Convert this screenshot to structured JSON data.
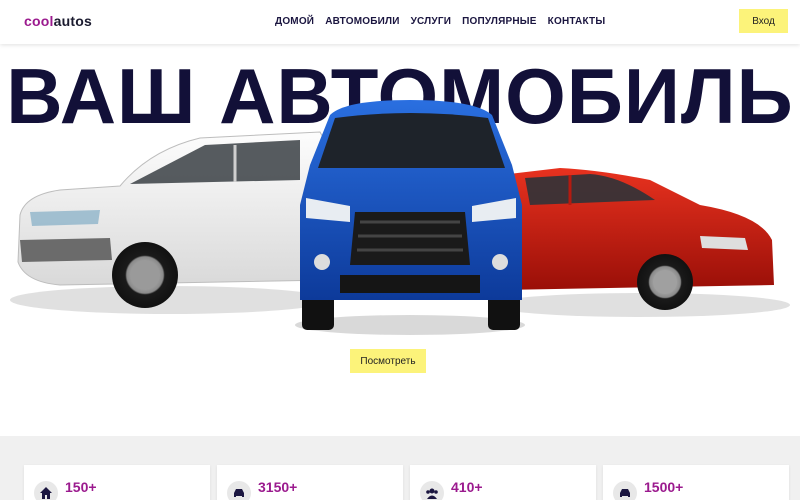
{
  "header": {
    "logo_part1": "cool",
    "logo_part2": "autos",
    "nav": [
      "ДОМОЙ",
      "АВТОМОБИЛИ",
      "УСЛУГИ",
      "ПОПУЛЯРНЫЕ",
      "КОНТАКТЫ"
    ],
    "login_label": "Вход"
  },
  "hero": {
    "title": "ВАШ АВТОМОБИЛЬ",
    "view_label": "Посмотреть"
  },
  "stats": [
    {
      "value": "150+",
      "icon": "home-icon"
    },
    {
      "value": "3150+",
      "icon": "car-icon"
    },
    {
      "value": "410+",
      "icon": "users-icon"
    },
    {
      "value": "1500+",
      "icon": "car-icon"
    }
  ],
  "colors": {
    "accent": "#9b1a8e",
    "button": "#fcf37a",
    "title": "#121038"
  }
}
